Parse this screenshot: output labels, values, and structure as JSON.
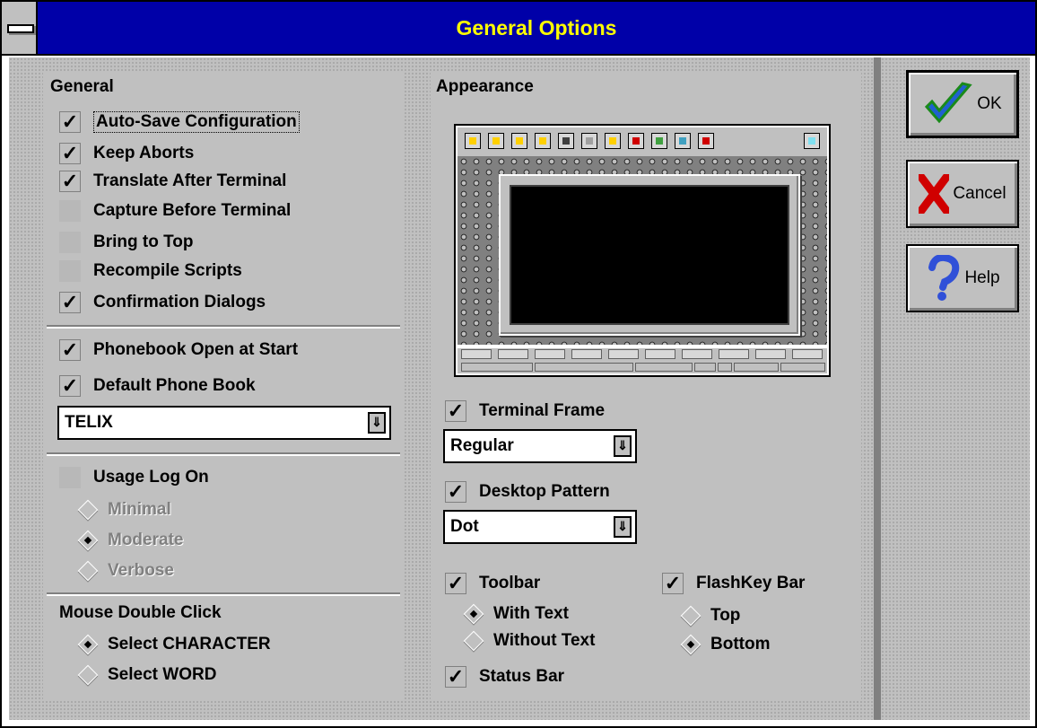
{
  "window": {
    "title": "General Options"
  },
  "general": {
    "heading": "General",
    "options": [
      {
        "label": "Auto-Save Configuration",
        "checked": true
      },
      {
        "label": "Keep Aborts",
        "checked": true
      },
      {
        "label": "Translate After Terminal",
        "checked": true
      },
      {
        "label": "Capture Before Terminal",
        "checked": false
      },
      {
        "label": "Bring to Top",
        "checked": false
      },
      {
        "label": "Recompile Scripts",
        "checked": false
      },
      {
        "label": "Confirmation Dialogs",
        "checked": true
      }
    ],
    "phonebook_open": {
      "label": "Phonebook Open at Start",
      "checked": true
    },
    "default_phonebook": {
      "label": "Default Phone Book",
      "checked": true,
      "value": "TELIX"
    },
    "usage_log": {
      "label": "Usage Log On",
      "checked": false,
      "levels": [
        {
          "label": "Minimal",
          "selected": false
        },
        {
          "label": "Moderate",
          "selected": true
        },
        {
          "label": "Verbose",
          "selected": false
        }
      ]
    },
    "mouse": {
      "heading": "Mouse Double Click",
      "options": [
        {
          "label": "Select CHARACTER",
          "selected": true
        },
        {
          "label": "Select WORD",
          "selected": false
        }
      ]
    }
  },
  "appearance": {
    "heading": "Appearance",
    "terminal_frame": {
      "label": "Terminal Frame",
      "checked": true,
      "value": "Regular"
    },
    "desktop_pattern": {
      "label": "Desktop Pattern",
      "checked": true,
      "value": "Dot"
    },
    "toolbar": {
      "label": "Toolbar",
      "checked": true,
      "options": [
        {
          "label": "With Text",
          "selected": true
        },
        {
          "label": "Without Text",
          "selected": false
        }
      ]
    },
    "flashkey": {
      "label": "FlashKey Bar",
      "checked": true,
      "options": [
        {
          "label": "Top",
          "selected": false
        },
        {
          "label": "Bottom",
          "selected": true
        }
      ]
    },
    "status_bar": {
      "label": "Status Bar",
      "checked": true
    }
  },
  "buttons": {
    "ok": "OK",
    "cancel": "Cancel",
    "help": "Help"
  },
  "glyphs": {
    "check": "✓",
    "dropdown": "⇓"
  },
  "colors": {
    "title_bar": "#0000a8",
    "title_text": "#ffff00",
    "face": "#c0c0c0"
  }
}
